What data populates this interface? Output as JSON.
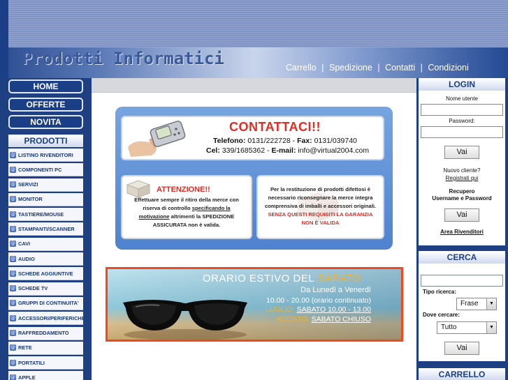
{
  "header": {
    "site_title": "Prodotti Informatici",
    "nav": [
      "Carrello",
      "Spedizione",
      "Contatti",
      "Condizioni"
    ],
    "nav_separator": "|"
  },
  "left_menu": {
    "buttons": [
      "HOME",
      "OFFERTE",
      "NOVITA"
    ],
    "products_heading": "PRODOTTI",
    "categories": [
      "LISTINO RIVENDITORI",
      "COMPONENTI PC",
      "SERVIZI",
      "MONITOR",
      "TASTIERE/MOUSE",
      "STAMPANTI/SCANNER",
      "CAVI",
      "AUDIO",
      "SCHEDE AGGIUNTIVE",
      "SCHEDE TV",
      "GRUPPI DI CONTINUITA'",
      "ACCESSORI/PERIFERICHE",
      "RAFFREDDAMENTO",
      "RETE",
      "PORTATILI",
      "APPLE"
    ]
  },
  "contact": {
    "title": "CONTATTACI!!",
    "phone_label": "Telefono:",
    "phone": "0131/222728",
    "fax_label": "Fax:",
    "fax": "0131/039740",
    "cel_label": "Cel:",
    "cel": "339/1685362",
    "email_label": "E-mail:",
    "email": "info@virtual2004.com"
  },
  "warning": {
    "title": "ATTENZIONE!!",
    "line1": "Effettuare sempre il ritiro della merce con",
    "line2_a": "riserva di controllo ",
    "line2_b": "specificando la",
    "line3_a": "motivazione",
    "line3_b": " altrimenti la SPEDIZIONE",
    "line4": "ASSICURATA non è valida."
  },
  "return_note": {
    "line1": "Per la restituzione di prodotti difettosi è",
    "line2": "necessario riconsegnare la merce integra",
    "line3": "comprensiva di imballi e accessori originali.",
    "line4": "SENZA QUESTI REQUISITI LA GARANZIA",
    "line5": "NON È VALIDA"
  },
  "summer": {
    "title_a": "ORARIO ESTIVO DEL ",
    "title_b": "SABATO",
    "days": "Da Lunedì a Venerdì",
    "hours": "10.00 - 20.00 (orario continuato)",
    "july_label": "LUGLIO:",
    "july_value": "SABATO 10.00 - 13.00",
    "august_label": "AGOSTO:",
    "august_value": "SABATO CHIUSO"
  },
  "login": {
    "heading": "LOGIN",
    "username_label": "Nome utente",
    "password_label": "Password:",
    "submit": "Vai",
    "new_client": "Nuovo cliente?",
    "register_link": "Registrati qui",
    "recover_line1": "Recupero",
    "recover_line2": "Username e Password",
    "recover_submit": "Vai",
    "reseller_link": "Area Rivenditori"
  },
  "search": {
    "heading": "CERCA",
    "type_label": "Tipo ricerca:",
    "type_value": "Frase",
    "where_label": "Dove cercare:",
    "where_value": "Tutto",
    "submit": "Vai"
  },
  "cart": {
    "heading": "CARRELLO"
  },
  "colors": {
    "brand_blue": "#1e3f82",
    "alert_red": "#e22b22",
    "summer_border": "#ee4a1e",
    "summer_accent": "#f0b234"
  }
}
